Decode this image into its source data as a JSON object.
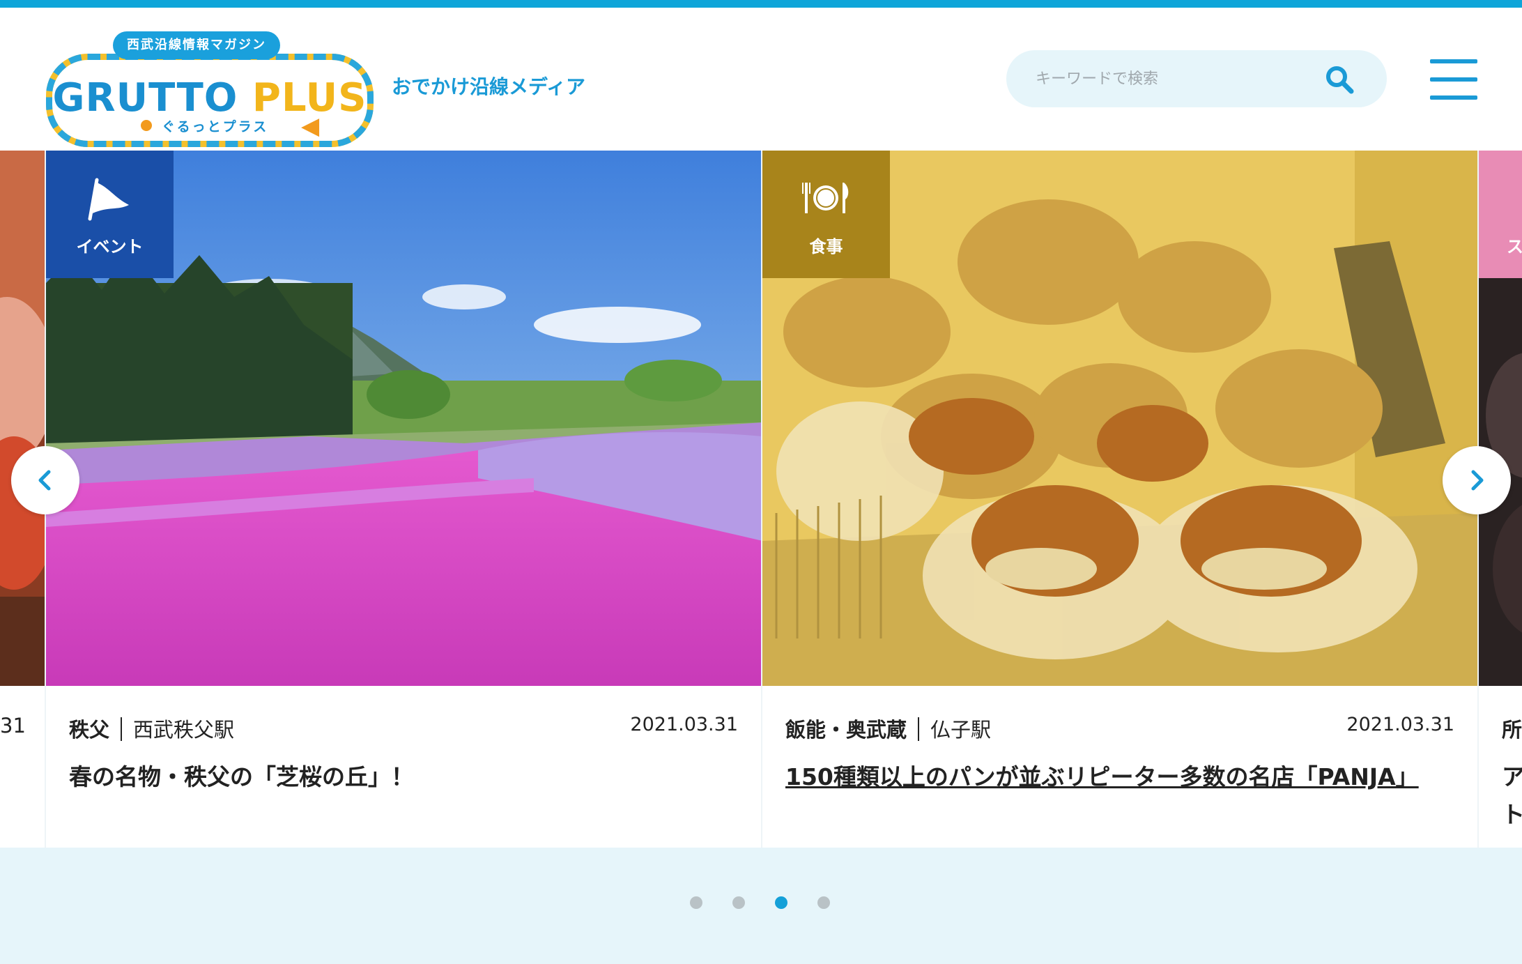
{
  "header": {
    "logo_tagline": "西武沿線情報マガジン",
    "logo_title_left": "GRUTTO",
    "logo_title_right": "PLUS",
    "logo_subtitle": "ぐるっとプラス",
    "site_tagline": "おでかけ沿線メディア",
    "search_placeholder": "キーワードで検索"
  },
  "carousel": {
    "cards": [
      {
        "badge": "イベント",
        "badge_color": "#1a4fa8",
        "area": "秩父",
        "station": "西武秩父駅",
        "date": "2021.03.31",
        "title": "春の名物・秩父の「芝桜の丘」！"
      },
      {
        "badge": "食事",
        "badge_color": "#a8841b",
        "area": "飯能・奥武蔵",
        "station": "仏子駅",
        "date": "2021.03.31",
        "title": "150種類以上のパンが並ぶリピーター多数の名店「PANJA」"
      }
    ],
    "left_peek": {
      "date_fragment": "31"
    },
    "right_peek": {
      "area_fragment": "所",
      "badge_fragment": "ス",
      "badge_color": "#e88cb5",
      "title_fragment_1": "ア",
      "title_fragment_2": "ト"
    },
    "dots": {
      "count": 4,
      "active_index": 2
    }
  }
}
